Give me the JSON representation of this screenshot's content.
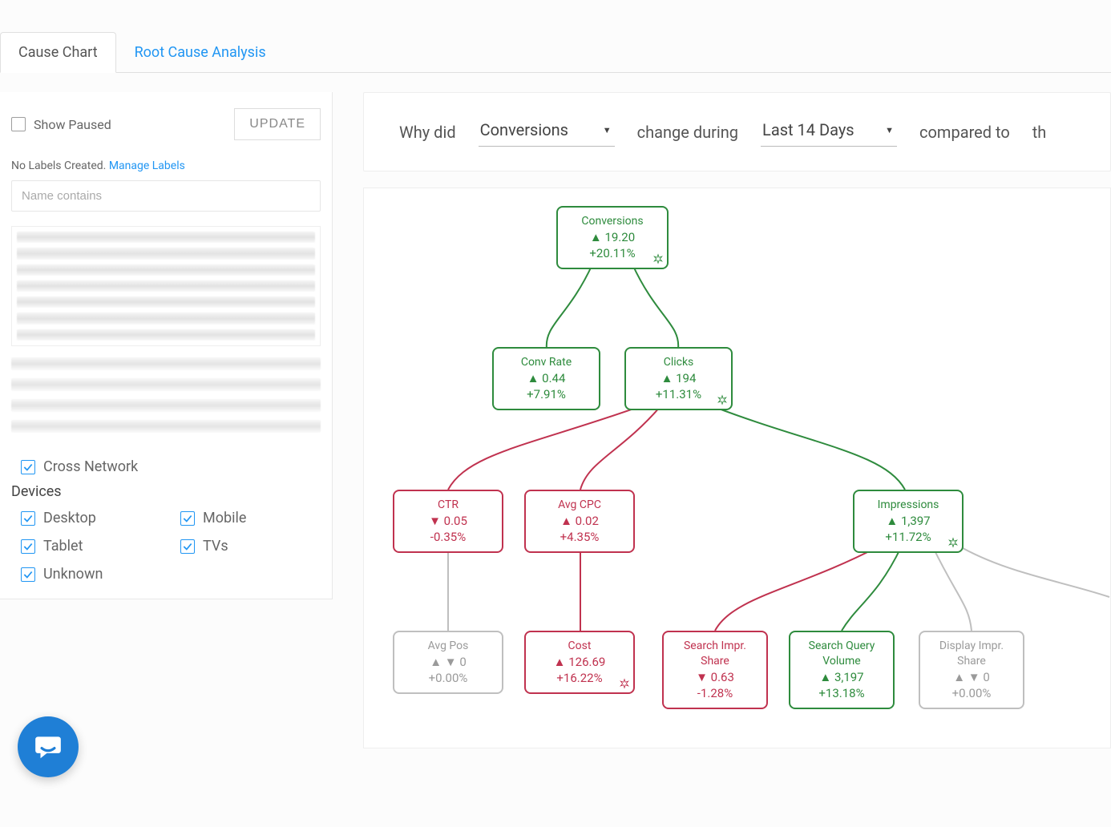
{
  "tabs": {
    "cause_chart": "Cause Chart",
    "root_cause": "Root Cause Analysis"
  },
  "sidebar": {
    "show_paused_label": "Show Paused",
    "update_label": "UPDATE",
    "no_labels_text": "No Labels Created. ",
    "manage_labels_link": "Manage Labels",
    "name_input_placeholder": "Name contains",
    "cross_network_label": "Cross Network",
    "devices_heading": "Devices",
    "devices": {
      "desktop": "Desktop",
      "mobile": "Mobile",
      "tablet": "Tablet",
      "tvs": "TVs",
      "unknown": "Unknown"
    }
  },
  "query": {
    "why_did": "Why did",
    "metric": "Conversions",
    "change_during": "change during",
    "period": "Last 14 Days",
    "compared_to": "compared to",
    "trailing": "th"
  },
  "nodes": {
    "conversions": {
      "title": "Conversions",
      "value": "▲ 19.20",
      "pct": "+20.11%"
    },
    "conv_rate": {
      "title": "Conv Rate",
      "value": "▲ 0.44",
      "pct": "+7.91%"
    },
    "clicks": {
      "title": "Clicks",
      "value": "▲ 194",
      "pct": "+11.31%"
    },
    "ctr": {
      "title": "CTR",
      "value": "▼ 0.05",
      "pct": "-0.35%"
    },
    "avg_cpc": {
      "title": "Avg CPC",
      "value": "▲ 0.02",
      "pct": "+4.35%"
    },
    "impressions": {
      "title": "Impressions",
      "value": "▲ 1,397",
      "pct": "+11.72%"
    },
    "avg_pos": {
      "title": "Avg Pos",
      "value": "▲ ▼ 0",
      "pct": "+0.00%"
    },
    "cost": {
      "title": "Cost",
      "value": "▲ 126.69",
      "pct": "+16.22%"
    },
    "sis": {
      "title": "Search Impr. Share",
      "value": "▼ 0.63",
      "pct": "-1.28%"
    },
    "sqv": {
      "title": "Search Query Volume",
      "value": "▲ 3,197",
      "pct": "+13.18%"
    },
    "dis": {
      "title": "Display Impr. Share",
      "value": "▲ ▼ 0",
      "pct": "+0.00%"
    }
  },
  "colors": {
    "green": "#2e8b3d",
    "red": "#c0324f",
    "grey": "#bfbfbf",
    "link": "#2196f3"
  },
  "chart_data": {
    "type": "tree",
    "title": "Cause Chart",
    "root": "Conversions",
    "nodes": [
      {
        "id": "conversions",
        "label": "Conversions",
        "delta": 19.2,
        "pct": 20.11,
        "direction": "up",
        "color": "green"
      },
      {
        "id": "conv_rate",
        "label": "Conv Rate",
        "delta": 0.44,
        "pct": 7.91,
        "direction": "up",
        "color": "green"
      },
      {
        "id": "clicks",
        "label": "Clicks",
        "delta": 194,
        "pct": 11.31,
        "direction": "up",
        "color": "green"
      },
      {
        "id": "ctr",
        "label": "CTR",
        "delta": 0.05,
        "pct": -0.35,
        "direction": "down",
        "color": "red"
      },
      {
        "id": "avg_cpc",
        "label": "Avg CPC",
        "delta": 0.02,
        "pct": 4.35,
        "direction": "up",
        "color": "red"
      },
      {
        "id": "impressions",
        "label": "Impressions",
        "delta": 1397,
        "pct": 11.72,
        "direction": "up",
        "color": "green"
      },
      {
        "id": "avg_pos",
        "label": "Avg Pos",
        "delta": 0,
        "pct": 0.0,
        "direction": "flat",
        "color": "grey"
      },
      {
        "id": "cost",
        "label": "Cost",
        "delta": 126.69,
        "pct": 16.22,
        "direction": "up",
        "color": "red"
      },
      {
        "id": "sis",
        "label": "Search Impr. Share",
        "delta": 0.63,
        "pct": -1.28,
        "direction": "down",
        "color": "red"
      },
      {
        "id": "sqv",
        "label": "Search Query Volume",
        "delta": 3197,
        "pct": 13.18,
        "direction": "up",
        "color": "green"
      },
      {
        "id": "dis",
        "label": "Display Impr. Share",
        "delta": 0,
        "pct": 0.0,
        "direction": "flat",
        "color": "grey"
      }
    ],
    "edges": [
      {
        "from": "conversions",
        "to": "conv_rate",
        "color": "green"
      },
      {
        "from": "conversions",
        "to": "clicks",
        "color": "green"
      },
      {
        "from": "clicks",
        "to": "ctr",
        "color": "red"
      },
      {
        "from": "clicks",
        "to": "avg_cpc",
        "color": "red"
      },
      {
        "from": "clicks",
        "to": "impressions",
        "color": "green"
      },
      {
        "from": "ctr",
        "to": "avg_pos",
        "color": "grey"
      },
      {
        "from": "avg_cpc",
        "to": "cost",
        "color": "red"
      },
      {
        "from": "impressions",
        "to": "sis",
        "color": "red"
      },
      {
        "from": "impressions",
        "to": "sqv",
        "color": "green"
      },
      {
        "from": "impressions",
        "to": "dis",
        "color": "grey"
      }
    ]
  }
}
